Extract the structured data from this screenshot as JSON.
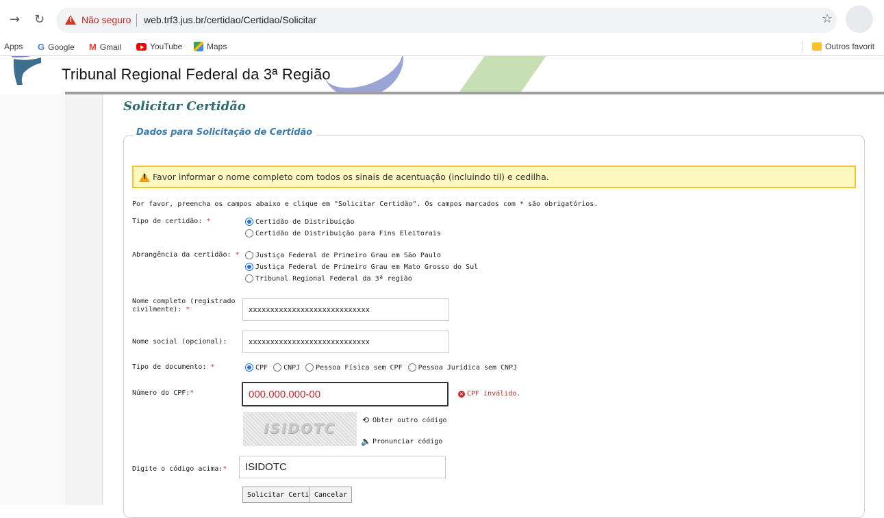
{
  "browser": {
    "insecure_label": "Não seguro",
    "url": "web.trf3.jus.br/certidao/Certidao/Solicitar",
    "bookmarks": {
      "apps": "Apps",
      "google": "Google",
      "gmail": "Gmail",
      "youtube": "YouTube",
      "maps": "Maps",
      "outros": "Outros favorit"
    }
  },
  "header": {
    "site_title": "Tribunal Regional Federal da 3ª Região"
  },
  "page": {
    "heading": "Solicitar Certidão",
    "legend": "Dados para Solicitação de Certidão",
    "alert": "Favor informar o nome completo com todos os sinais de acentuação (incluindo til) e cedilha.",
    "intro": "Por favor, preencha os campos abaixo e clique em \"Solicitar Certidão\". Os campos marcados com * são obrigatórios."
  },
  "form": {
    "tipo_certidao": {
      "label": "Tipo de certidão:",
      "options": [
        "Certidão de Distribuição",
        "Certidão de Distribuição para Fins Eleitorais"
      ],
      "selected_index": 0
    },
    "abrangencia": {
      "label": "Abrangência da certidão:",
      "options": [
        "Justiça Federal de Primeiro Grau em São Paulo",
        "Justiça Federal de Primeiro Grau em Mato Grosso do Sul",
        "Tribunal Regional Federal da 3ª região"
      ],
      "selected_index": 1
    },
    "nome_completo": {
      "label_line1": "Nome completo (registrado",
      "label_line2": "civilmente):",
      "value": "xxxxxxxxxxxxxxxxxxxxxxxxxxxx"
    },
    "nome_social": {
      "label": "Nome social (opcional):",
      "value": "xxxxxxxxxxxxxxxxxxxxxxxxxxxx"
    },
    "tipo_documento": {
      "label": "Tipo de documento:",
      "options": [
        "CPF",
        "CNPJ",
        "Pessoa Física sem CPF",
        "Pessoa Jurídica sem CNPJ"
      ],
      "selected_index": 0
    },
    "numero_cpf": {
      "label": "Número do CPF:",
      "value": "000.000.000-00",
      "error": "CPF inválido."
    },
    "captcha": {
      "image_text": "ISIDOTC",
      "refresh_label": "Obter outro código",
      "audio_label": "Pronunciar código"
    },
    "codigo": {
      "label": "Digite o código acima:",
      "value": "ISIDOTC"
    },
    "required_mark": "*",
    "submit_label": "Solicitar Certidão",
    "cancel_label": "Cancelar"
  },
  "colors": {
    "heading": "#2e6a6e",
    "legend": "#3a7cb0",
    "alert_bg": "#fcf8bf",
    "alert_border": "#f1c232",
    "error": "#c62828",
    "required": "#d32f2f"
  }
}
